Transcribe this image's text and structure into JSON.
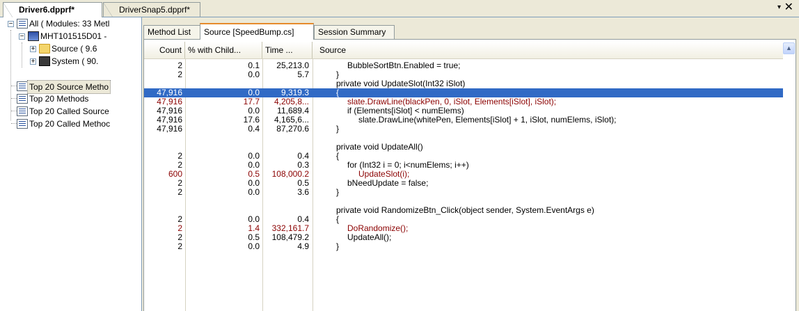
{
  "doc_tabs": [
    {
      "label": "Driver6.dpprf*",
      "active": true
    },
    {
      "label": "DriverSnap5.dpprf*",
      "active": false
    }
  ],
  "tab_controls": {
    "dropdown": "▾",
    "close": "✕"
  },
  "tree": {
    "root": "All ( Modules: 33 Metl",
    "machine": "MHT101515D01 -",
    "source": "Source ( 9.6",
    "system": "System ( 90.",
    "items": [
      "Top 20 Source Metho",
      "Top 20 Methods",
      "Top 20 Called Source",
      "Top 20 Called Methoc"
    ]
  },
  "view_tabs": [
    "Method List",
    "Source [SpeedBump.cs]",
    "Session Summary"
  ],
  "columns": {
    "count": "Count",
    "pct": "% with Child...",
    "time": "Time ...",
    "source": "Source"
  },
  "colors": {
    "hot_text": "#8b0000",
    "selection": "#316ac5"
  },
  "rows": [
    {
      "count": "2",
      "pct": "0.1",
      "time": "25,213.0",
      "src": "BubbleSortBtn.Enabled = true;",
      "indent": 1,
      "hot": false,
      "sel": false
    },
    {
      "count": "2",
      "pct": "0.0",
      "time": "5.7",
      "src": "}",
      "indent": 0,
      "hot": false,
      "sel": false
    },
    {
      "count": "",
      "pct": "",
      "time": "",
      "src": "private void UpdateSlot(Int32 iSlot)",
      "indent": 0,
      "hot": false,
      "sel": false
    },
    {
      "count": "47,916",
      "pct": "0.0",
      "time": "9,319.3",
      "src": "{",
      "indent": 0,
      "hot": false,
      "sel": true
    },
    {
      "count": "47,916",
      "pct": "17.7",
      "time": "4,205,8...",
      "src": "slate.DrawLine(blackPen, 0, iSlot, Elements[iSlot], iSlot);",
      "indent": 1,
      "hot": true,
      "sel": false
    },
    {
      "count": "47,916",
      "pct": "0.0",
      "time": "11,689.4",
      "src": "if (Elements[iSlot] < numElems)",
      "indent": 1,
      "hot": false,
      "sel": false
    },
    {
      "count": "47,916",
      "pct": "17.6",
      "time": "4,165,6...",
      "src": "slate.DrawLine(whitePen, Elements[iSlot] + 1, iSlot, numElems, iSlot);",
      "indent": 2,
      "hot": false,
      "sel": false
    },
    {
      "count": "47,916",
      "pct": "0.4",
      "time": "87,270.6",
      "src": "}",
      "indent": 0,
      "hot": false,
      "sel": false
    },
    {
      "count": "",
      "pct": "",
      "time": "",
      "src": "",
      "indent": 0,
      "hot": false,
      "sel": false
    },
    {
      "count": "",
      "pct": "",
      "time": "",
      "src": "private void UpdateAll()",
      "indent": 0,
      "hot": false,
      "sel": false
    },
    {
      "count": "2",
      "pct": "0.0",
      "time": "0.4",
      "src": "{",
      "indent": 0,
      "hot": false,
      "sel": false
    },
    {
      "count": "2",
      "pct": "0.0",
      "time": "0.3",
      "src": "for (Int32 i = 0; i<numElems; i++)",
      "indent": 1,
      "hot": false,
      "sel": false
    },
    {
      "count": "600",
      "pct": "0.5",
      "time": "108,000.2",
      "src": "UpdateSlot(i);",
      "indent": 2,
      "hot": true,
      "sel": false
    },
    {
      "count": "2",
      "pct": "0.0",
      "time": "0.5",
      "src": "bNeedUpdate = false;",
      "indent": 1,
      "hot": false,
      "sel": false
    },
    {
      "count": "2",
      "pct": "0.0",
      "time": "3.6",
      "src": "}",
      "indent": 0,
      "hot": false,
      "sel": false
    },
    {
      "count": "",
      "pct": "",
      "time": "",
      "src": "",
      "indent": 0,
      "hot": false,
      "sel": false
    },
    {
      "count": "",
      "pct": "",
      "time": "",
      "src": "private void RandomizeBtn_Click(object sender, System.EventArgs e)",
      "indent": 0,
      "hot": false,
      "sel": false
    },
    {
      "count": "2",
      "pct": "0.0",
      "time": "0.4",
      "src": "{",
      "indent": 0,
      "hot": false,
      "sel": false
    },
    {
      "count": "2",
      "pct": "1.4",
      "time": "332,161.7",
      "src": "DoRandomize();",
      "indent": 1,
      "hot": true,
      "sel": false
    },
    {
      "count": "2",
      "pct": "0.5",
      "time": "108,479.2",
      "src": "UpdateAll();",
      "indent": 1,
      "hot": false,
      "sel": false
    },
    {
      "count": "2",
      "pct": "0.0",
      "time": "4.9",
      "src": "}",
      "indent": 0,
      "hot": false,
      "sel": false
    }
  ]
}
